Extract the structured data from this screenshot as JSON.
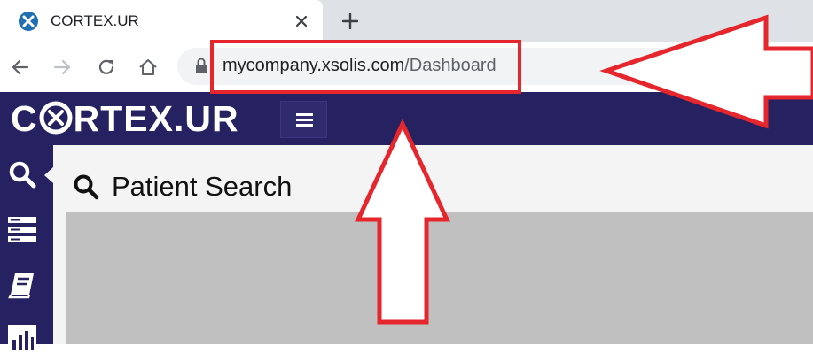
{
  "browser": {
    "tab": {
      "title": "CORTEX.UR",
      "favicon": "xsolis-x-icon"
    },
    "toolbar": {
      "back_icon": "back-arrow-icon",
      "forward_icon": "forward-arrow-icon",
      "reload_icon": "reload-icon",
      "home_icon": "home-icon",
      "lock_icon": "lock-icon"
    },
    "address": {
      "domain": "mycompany.xsolis.com",
      "path": "/Dashboard"
    }
  },
  "app": {
    "brand": {
      "prefix": "C",
      "suffix": "RTEX.UR"
    },
    "colors": {
      "navbar": "#262262",
      "content_bg": "#f4f4f4",
      "annotation": "#e6262d"
    },
    "sidebar": [
      {
        "icon": "search-icon",
        "active": true
      },
      {
        "icon": "list-icon"
      },
      {
        "icon": "book-icon"
      },
      {
        "icon": "chart-icon"
      }
    ],
    "page": {
      "title": "Patient Search",
      "title_icon": "search-icon"
    }
  },
  "annotations": [
    "url-highlight-box",
    "left-pointing-arrow",
    "up-pointing-arrow"
  ]
}
